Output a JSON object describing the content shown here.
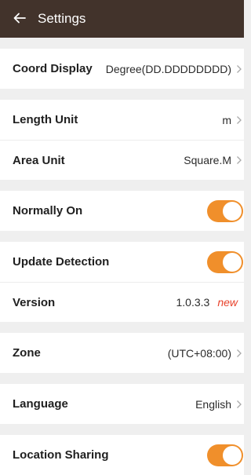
{
  "appbar": {
    "title": "Settings",
    "back_icon": "arrow-left-icon"
  },
  "rows": {
    "coord_display": {
      "label": "Coord Display",
      "value": "Degree(DD.DDDDDDDD)"
    },
    "length_unit": {
      "label": "Length Unit",
      "value": "m"
    },
    "area_unit": {
      "label": "Area Unit",
      "value": "Square.M"
    },
    "normally_on": {
      "label": "Normally On",
      "enabled": true
    },
    "update_detection": {
      "label": "Update Detection",
      "enabled": true
    },
    "version": {
      "label": "Version",
      "value": "1.0.3.3",
      "badge": "new"
    },
    "zone": {
      "label": "Zone",
      "value": "(UTC+08:00)"
    },
    "language": {
      "label": "Language",
      "value": "English"
    },
    "location_sharing": {
      "label": "Location Sharing",
      "enabled": true
    }
  },
  "colors": {
    "appbar_bg": "#42332b",
    "toggle_on": "#f08f2b",
    "new_badge": "#e8432c",
    "page_bg": "#efefef"
  }
}
